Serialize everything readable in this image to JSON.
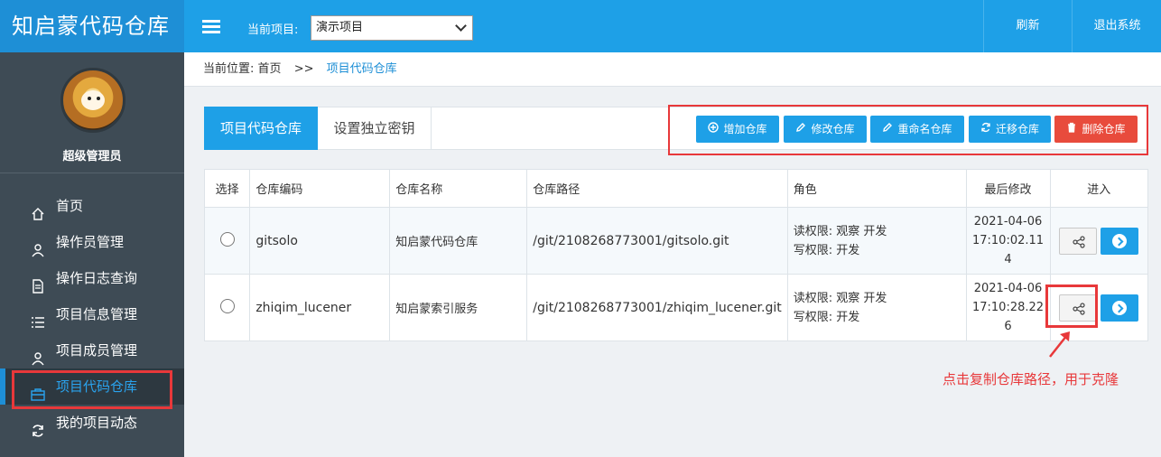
{
  "app": {
    "title": "知启蒙代码仓库",
    "user_name": "超级管理员"
  },
  "topbar": {
    "project_label": "当前项目:",
    "project_selected": "演示项目",
    "refresh_label": "刷新",
    "logout_label": "退出系统"
  },
  "breadcrumb": {
    "prefix": "当前位置:",
    "home": "首页",
    "separator": ">>",
    "current": "项目代码仓库"
  },
  "sidebar": {
    "items": [
      {
        "label": "首页",
        "icon": "home-icon"
      },
      {
        "label": "操作员管理",
        "icon": "user-icon"
      },
      {
        "label": "操作日志查询",
        "icon": "document-icon"
      },
      {
        "label": "项目信息管理",
        "icon": "list-icon"
      },
      {
        "label": "项目成员管理",
        "icon": "user-icon"
      },
      {
        "label": "项目代码仓库",
        "icon": "briefcase-icon",
        "active": true
      },
      {
        "label": "我的项目动态",
        "icon": "refresh-icon"
      }
    ]
  },
  "tabs": [
    {
      "label": "项目代码仓库",
      "active": true
    },
    {
      "label": "设置独立密钥",
      "active": false
    }
  ],
  "actions": {
    "add": "增加仓库",
    "edit": "修改仓库",
    "rename": "重命名仓库",
    "migrate": "迁移仓库",
    "delete": "删除仓库"
  },
  "table": {
    "headers": {
      "select": "选择",
      "code": "仓库编码",
      "name": "仓库名称",
      "path": "仓库路径",
      "role": "角色",
      "modified": "最后修改",
      "enter": "进入"
    },
    "rows": [
      {
        "code": "gitsolo",
        "name": "知启蒙代码仓库",
        "path": "/git/2108268773001/gitsolo.git",
        "read_perm": "读权限: 观察 开发",
        "write_perm": "写权限: 开发",
        "modified_1": "2021-04-06",
        "modified_2": "17:10:02.11",
        "modified_3": "4"
      },
      {
        "code": "zhiqim_lucener",
        "name": "知启蒙索引服务",
        "path": "/git/2108268773001/zhiqim_lucener.git",
        "read_perm": "读权限: 观察 开发",
        "write_perm": "写权限: 开发",
        "modified_1": "2021-04-06",
        "modified_2": "17:10:28.22",
        "modified_3": "6"
      }
    ]
  },
  "annotation": {
    "note": "点击复制仓库路径，用于克隆"
  },
  "colors": {
    "brand": "#1e8fd6",
    "topbar": "#1ea0e7",
    "sidebar": "#3e4b55",
    "danger": "#e84b3c",
    "highlight": "#e8383a"
  }
}
